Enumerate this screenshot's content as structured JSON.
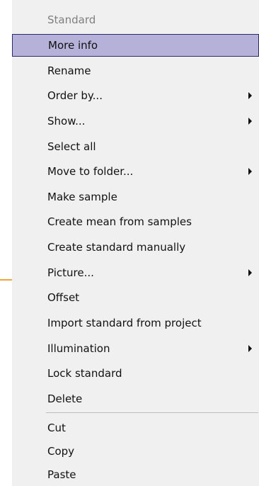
{
  "menu": {
    "header": "Standard",
    "items": [
      {
        "label": "More info"
      },
      {
        "label": "Rename"
      },
      {
        "label": "Order by..."
      },
      {
        "label": "Show..."
      },
      {
        "label": "Select all"
      },
      {
        "label": "Move to folder..."
      },
      {
        "label": "Make sample"
      },
      {
        "label": "Create mean from samples"
      },
      {
        "label": "Create standard manually"
      },
      {
        "label": "Picture..."
      },
      {
        "label": "Offset"
      },
      {
        "label": "Import standard from project"
      },
      {
        "label": "Illumination"
      },
      {
        "label": "Lock standard"
      },
      {
        "label": "Delete"
      },
      {
        "label": "Cut"
      },
      {
        "label": "Copy"
      },
      {
        "label": "Paste"
      }
    ]
  },
  "colors": {
    "selected_bg": "#b6b1d9",
    "selected_border": "#2a2a6a",
    "menu_bg": "#f0f0f0",
    "connector": "#f2a43a"
  }
}
